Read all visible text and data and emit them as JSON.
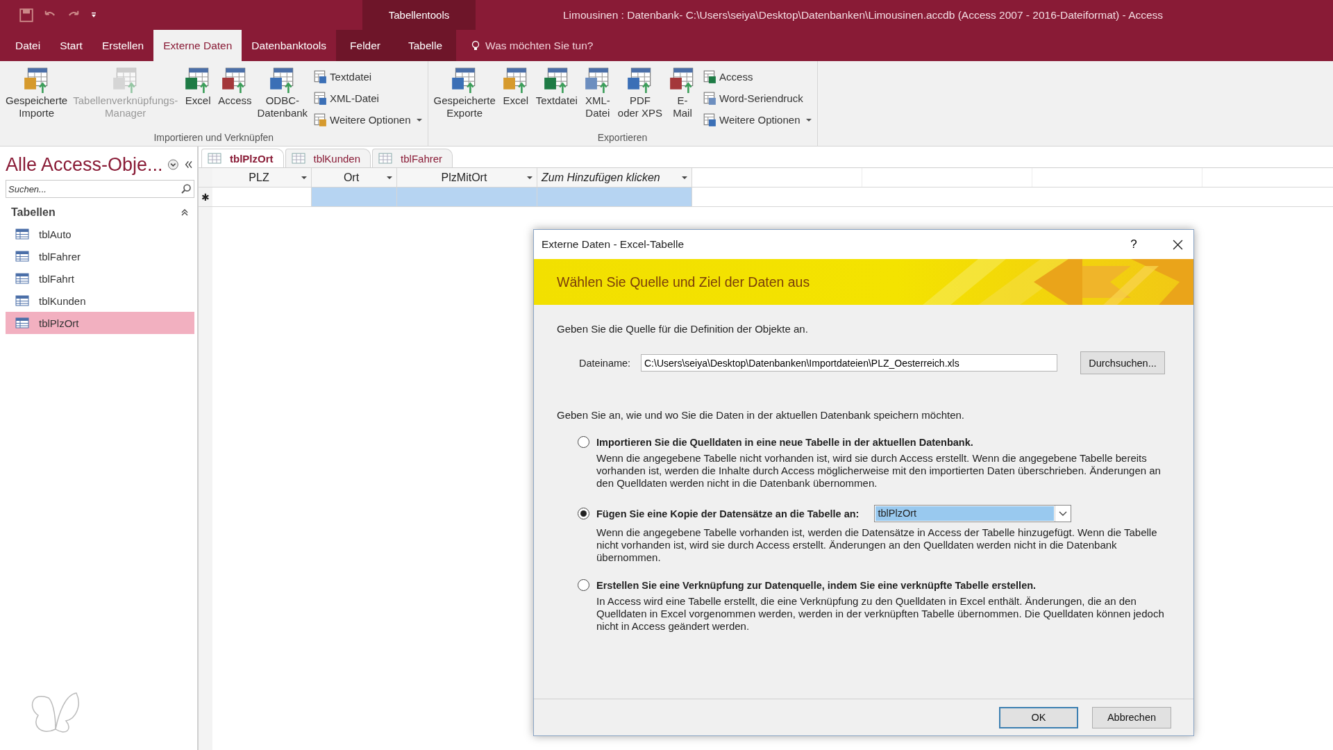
{
  "title_bar": {
    "context_label": "Tabellentools",
    "title": "Limousinen : Datenbank- C:\\Users\\seiya\\Desktop\\Datenbanken\\Limousinen.accdb (Access 2007 - 2016-Dateiformat)  -  Access"
  },
  "ribbon_tabs": [
    {
      "label": "Datei",
      "selected": false,
      "kind": "normal"
    },
    {
      "label": "Start",
      "selected": false,
      "kind": "normal"
    },
    {
      "label": "Erstellen",
      "selected": false,
      "kind": "normal"
    },
    {
      "label": "Externe Daten",
      "selected": true,
      "kind": "normal"
    },
    {
      "label": "Datenbanktools",
      "selected": false,
      "kind": "normal"
    },
    {
      "label": "Felder",
      "selected": false,
      "kind": "context"
    },
    {
      "label": "Tabelle",
      "selected": false,
      "kind": "context"
    }
  ],
  "tell_me": {
    "placeholder": "Was möchten Sie tun?"
  },
  "ribbon_groups": [
    {
      "label": "Importieren und Verknüpfen",
      "large": [
        {
          "label": "Gespeicherte\nImporte",
          "disabled": false
        },
        {
          "label": "Tabellenverknüpfungs-\nManager",
          "disabled": true
        },
        {
          "label": "Excel",
          "disabled": false
        },
        {
          "label": "Access",
          "disabled": false
        },
        {
          "label": "ODBC-\nDatenbank",
          "disabled": false
        }
      ],
      "small": [
        {
          "label": "Textdatei",
          "dropdown": false
        },
        {
          "label": "XML-Datei",
          "dropdown": false
        },
        {
          "label": "Weitere Optionen",
          "dropdown": true
        }
      ]
    },
    {
      "label": "Exportieren",
      "large": [
        {
          "label": "Gespeicherte\nExporte",
          "disabled": false
        },
        {
          "label": "Excel",
          "disabled": false
        },
        {
          "label": "Textdatei",
          "disabled": false
        },
        {
          "label": "XML-\nDatei",
          "disabled": false
        },
        {
          "label": "PDF\noder XPS",
          "disabled": false
        },
        {
          "label": "E-\nMail",
          "disabled": false
        }
      ],
      "small": [
        {
          "label": "Access",
          "dropdown": false
        },
        {
          "label": "Word-Seriendruck",
          "dropdown": false
        },
        {
          "label": "Weitere Optionen",
          "dropdown": true
        }
      ]
    }
  ],
  "nav_pane": {
    "title": "Alle Access-Obje...",
    "search": {
      "placeholder": "Suchen..."
    },
    "section": "Tabellen",
    "items": [
      {
        "label": "tblAuto",
        "selected": false
      },
      {
        "label": "tblFahrer",
        "selected": false
      },
      {
        "label": "tblFahrt",
        "selected": false
      },
      {
        "label": "tblKunden",
        "selected": false
      },
      {
        "label": "tblPlzOrt",
        "selected": true
      }
    ]
  },
  "doc_tabs": [
    {
      "label": "tblPlzOrt",
      "selected": true
    },
    {
      "label": "tblKunden",
      "selected": false
    },
    {
      "label": "tblFahrer",
      "selected": false
    }
  ],
  "grid": {
    "columns": [
      {
        "label": "PLZ",
        "kind": "field"
      },
      {
        "label": "Ort",
        "kind": "field"
      },
      {
        "label": "PlzMitOrt",
        "kind": "field"
      },
      {
        "label": "Zum Hinzufügen klicken",
        "kind": "add"
      }
    ],
    "new_row": {
      "marker": "✱",
      "cells": [
        {
          "selected": false
        },
        {
          "selected": true
        },
        {
          "selected": true
        },
        {
          "selected": true
        }
      ]
    }
  },
  "dialog": {
    "title": "Externe Daten - Excel-Tabelle",
    "help": "?",
    "banner": "Wählen Sie Quelle und Ziel der Daten aus",
    "source_prompt": "Geben Sie die Quelle für die Definition der Objekte an.",
    "filename": {
      "label": "Dateiname:",
      "value": "C:\\Users\\seiya\\Desktop\\Datenbanken\\Importdateien\\PLZ_Oesterreich.xls"
    },
    "browse_button": "Durchsuchen...",
    "target_prompt": "Geben Sie an, wie und wo Sie die Daten in der aktuellen Datenbank speichern möchten.",
    "options": [
      {
        "label": "Importieren Sie die Quelldaten in eine neue Tabelle in der aktuellen Datenbank.",
        "selected": false,
        "description": "Wenn die angegebene Tabelle nicht vorhanden ist, wird sie durch Access erstellt. Wenn die angegebene Tabelle bereits vorhanden ist, werden die Inhalte durch Access möglicherweise mit den importierten Daten überschrieben. Änderungen an den Quelldaten werden nicht in die Datenbank übernommen."
      },
      {
        "label": "Fügen Sie eine Kopie der Datensätze an die Tabelle an:",
        "selected": true,
        "table_select": "tblPlzOrt",
        "description": "Wenn die angegebene Tabelle vorhanden ist, werden die Datensätze in Access der Tabelle hinzugefügt. Wenn die Tabelle nicht vorhanden ist, wird sie durch Access erstellt. Änderungen an den Quelldaten werden nicht in die Datenbank übernommen."
      },
      {
        "label": "Erstellen Sie eine Verknüpfung zur Datenquelle, indem Sie eine verknüpfte Tabelle erstellen.",
        "selected": false,
        "description": "In Access wird eine Tabelle erstellt, die eine Verknüpfung zu den Quelldaten in Excel enthält. Änderungen, die an den Quelldaten in Excel vorgenommen werden, werden in der verknüpften Tabelle übernommen. Die Quelldaten können jedoch nicht in Access geändert werden."
      }
    ],
    "buttons": [
      {
        "label": "OK",
        "default": true
      },
      {
        "label": "Abbrechen",
        "default": false
      }
    ]
  }
}
